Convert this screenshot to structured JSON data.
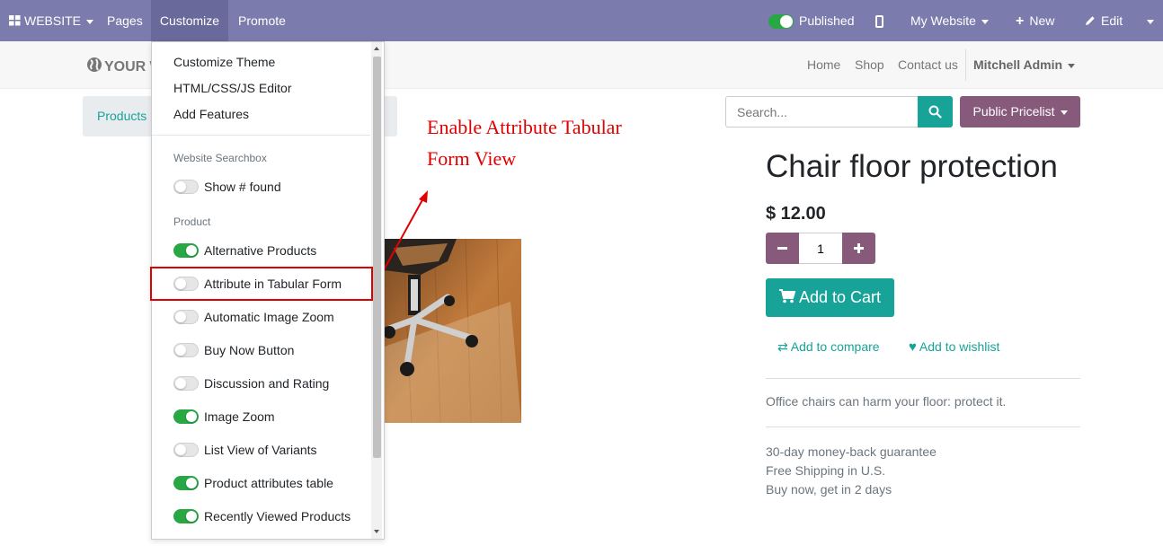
{
  "topbar": {
    "website_label": "WEBSITE",
    "pages": "Pages",
    "customize": "Customize",
    "promote": "Promote",
    "published": "Published",
    "my_website": "My Website",
    "new": "New",
    "edit": "Edit"
  },
  "site": {
    "logo_text": "YOUR W",
    "nav": [
      "Home",
      "Shop",
      "Contact us"
    ],
    "user": "Mitchell Admin"
  },
  "breadcrumb": {
    "products": "Products"
  },
  "search": {
    "placeholder": "Search..."
  },
  "pricelist": "Public Pricelist",
  "annotation": {
    "line1": "Enable Attribute Tabular",
    "line2": "Form View",
    "color": "#e00000"
  },
  "product": {
    "name": "Chair floor protection",
    "price": "$ 12.00",
    "quantity": "1",
    "add_to_cart": "Add to Cart",
    "add_to_compare": "Add to compare",
    "add_to_wishlist": "Add to wishlist",
    "description": "Office chairs can harm your floor: protect it.",
    "terms": [
      "30-day money-back guarantee",
      "Free Shipping in U.S.",
      "Buy now, get in 2 days"
    ]
  },
  "dropdown": {
    "links": [
      "Customize Theme",
      "HTML/CSS/JS Editor",
      "Add Features"
    ],
    "searchbox_header": "Website Searchbox",
    "show_found": "Show # found",
    "product_header": "Product",
    "options": [
      {
        "label": "Alternative Products",
        "on": true
      },
      {
        "label": "Attribute in Tabular Form",
        "on": false
      },
      {
        "label": "Automatic Image Zoom",
        "on": false
      },
      {
        "label": "Buy Now Button",
        "on": false
      },
      {
        "label": "Discussion and Rating",
        "on": false
      },
      {
        "label": "Image Zoom",
        "on": true
      },
      {
        "label": "List View of Variants",
        "on": false
      },
      {
        "label": "Product attributes table",
        "on": true
      },
      {
        "label": "Recently Viewed Products",
        "on": true
      }
    ]
  },
  "colors": {
    "topbar": "#7c7bad",
    "teal": "#17a398",
    "purple": "#875a7b",
    "toggle_on": "#28a745",
    "highlight": "#e00000"
  }
}
